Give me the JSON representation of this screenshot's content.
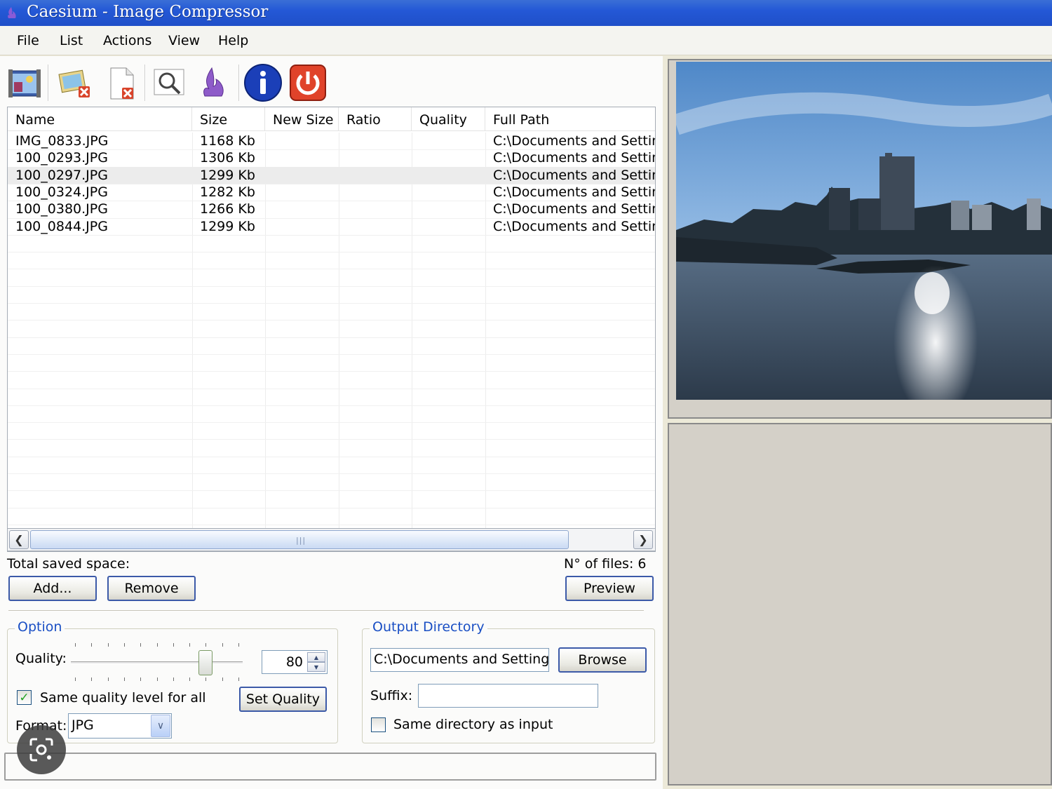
{
  "window": {
    "title": "Caesium - Image Compressor"
  },
  "menu": [
    "File",
    "List",
    "Actions",
    "View",
    "Help"
  ],
  "toolbar": {
    "buttons": [
      "add-images-icon",
      "clear-list-icon",
      "remove-file-icon",
      "preview-magnifier-icon",
      "compress-flame-icon",
      "info-icon",
      "exit-power-icon"
    ]
  },
  "list": {
    "columns": [
      "Name",
      "Size",
      "New Size",
      "Ratio",
      "Quality",
      "Full Path"
    ],
    "rows": [
      {
        "name": "IMG_0833.JPG",
        "size": "1168 Kb",
        "new_size": "",
        "ratio": "",
        "quality": "",
        "path": "C:\\Documents and Settings"
      },
      {
        "name": "100_0293.JPG",
        "size": "1306 Kb",
        "new_size": "",
        "ratio": "",
        "quality": "",
        "path": "C:\\Documents and Settings"
      },
      {
        "name": "100_0297.JPG",
        "size": "1299 Kb",
        "new_size": "",
        "ratio": "",
        "quality": "",
        "path": "C:\\Documents and Settings"
      },
      {
        "name": "100_0324.JPG",
        "size": "1282 Kb",
        "new_size": "",
        "ratio": "",
        "quality": "",
        "path": "C:\\Documents and Settings"
      },
      {
        "name": "100_0380.JPG",
        "size": "1266 Kb",
        "new_size": "",
        "ratio": "",
        "quality": "",
        "path": "C:\\Documents and Settings"
      },
      {
        "name": "100_0844.JPG",
        "size": "1299 Kb",
        "new_size": "",
        "ratio": "",
        "quality": "",
        "path": "C:\\Documents and Settings"
      }
    ],
    "selected_row": 2
  },
  "summary": {
    "saved_space_label": "Total saved space:",
    "files_count_label": "N° of files: 6"
  },
  "buttons": {
    "add": "Add...",
    "remove": "Remove",
    "preview": "Preview",
    "set_quality": "Set Quality",
    "browse": "Browse"
  },
  "option": {
    "title": "Option",
    "quality_label": "Quality:",
    "quality_value": "80",
    "quality_level": 0.8,
    "same_quality_label": "Same quality level for all",
    "same_quality_checked": true,
    "format_label": "Format:",
    "format_value": "JPG"
  },
  "output": {
    "title": "Output Directory",
    "directory_value": "C:\\Documents and Settings\\",
    "suffix_label": "Suffix:",
    "suffix_value": "",
    "same_dir_label": "Same directory as input",
    "same_dir_checked": false
  },
  "colors": {
    "title_bar": "#2458d6",
    "group_title": "#1a4fc4",
    "button_border": "#3c5aa8",
    "check_mark": "#21a121"
  }
}
